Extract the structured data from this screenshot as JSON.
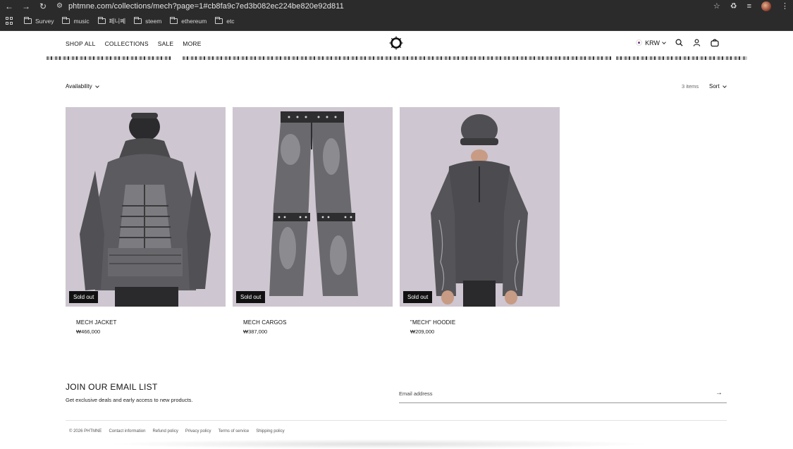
{
  "browser": {
    "url": "phtmne.com/collections/mech?page=1#cb8fa9c7ed3b082ec224be820e92d811",
    "bookmarks": [
      "Survey",
      "music",
      "페니쩨",
      "steem",
      "ethereum",
      "etc"
    ]
  },
  "header": {
    "menu": [
      "SHOP ALL",
      "COLLECTIONS",
      "SALE",
      "MORE"
    ],
    "currency": "KRW"
  },
  "toolbar": {
    "availability_label": "Availability",
    "item_count": "3 items",
    "sort_label": "Sort"
  },
  "products": [
    {
      "name": "MECH JACKET",
      "price": "₩466,000",
      "badge": "Sold out"
    },
    {
      "name": "MECH CARGOS",
      "price": "₩387,000",
      "badge": "Sold out"
    },
    {
      "name": "\"MECH\" HOODIE",
      "price": "₩209,000",
      "badge": "Sold out"
    }
  ],
  "newsletter": {
    "title": "JOIN OUR EMAIL LIST",
    "subtitle": "Get exclusive deals and early access to new products.",
    "placeholder": "Email address"
  },
  "footer": {
    "links": [
      "© 2026 PHTMNE",
      "Contact information",
      "Refund policy",
      "Privacy policy",
      "Terms of service",
      "Shipping policy"
    ]
  },
  "colors": {
    "chrome": "#2b2b2b",
    "product_bg": "#cec6d0",
    "badge_bg": "#111111"
  }
}
